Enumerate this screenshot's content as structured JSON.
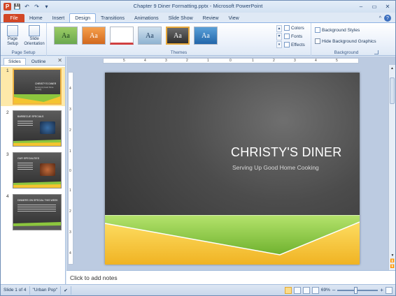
{
  "window": {
    "title": "Chapter 9 Diner Formatting.pptx - Microsoft PowerPoint",
    "app_icon_letter": "P",
    "controls": {
      "minimize": "–",
      "maximize": "▭",
      "close": "✕"
    }
  },
  "qat": {
    "save": "💾",
    "undo": "↶",
    "redo": "↷",
    "customize": "▾"
  },
  "tabs": {
    "file": "File",
    "items": [
      "Home",
      "Insert",
      "Design",
      "Transitions",
      "Animations",
      "Slide Show",
      "Review",
      "View"
    ],
    "active": "Design",
    "minimize_ribbon": "^",
    "help": "?"
  },
  "ribbon": {
    "page_setup": {
      "label": "Page Setup",
      "page_setup_btn": "Page Setup",
      "orientation_btn": "Slide Orientation"
    },
    "themes": {
      "label": "Themes",
      "thumbs": [
        "Aa",
        "Aa",
        "",
        "Aa",
        "Aa",
        "Aa"
      ],
      "colors": "Colors",
      "fonts": "Fonts",
      "effects": "Effects"
    },
    "background": {
      "label": "Background",
      "styles": "Background Styles",
      "hide_graphics": "Hide Background Graphics"
    }
  },
  "left_panel": {
    "tab_slides": "Slides",
    "tab_outline": "Outline",
    "close": "✕",
    "slides": [
      {
        "num": "1",
        "title": "CHRISTY'S DINER",
        "subtitle": "Serving Up Good Home Cooking"
      },
      {
        "num": "2",
        "title": "BARBECUE SPECIALS"
      },
      {
        "num": "3",
        "title": "OUR SPECIALTIES"
      },
      {
        "num": "4",
        "title": "DINNERS ON SPECIAL THIS WEEK"
      }
    ]
  },
  "slide": {
    "title": "CHRISTY'S DINER",
    "subtitle": "Serving Up Good Home Cooking"
  },
  "ruler": {
    "h_ticks": [
      "6",
      "5",
      "4",
      "3",
      "2",
      "1",
      "0",
      "1",
      "2",
      "3",
      "4",
      "5",
      "6"
    ],
    "v_ticks": [
      "4",
      "3",
      "2",
      "1",
      "0",
      "1",
      "2",
      "3",
      "4"
    ]
  },
  "notes": {
    "placeholder": "Click to add notes"
  },
  "status": {
    "slide_info": "Slide 1 of 4",
    "theme": "\"Urban Pop\"",
    "zoom": "69%",
    "minus": "–",
    "plus": "+"
  },
  "colors": {
    "file_tab": "#d24726",
    "accent_green": "#8cc63e",
    "accent_yellow": "#f4c430",
    "selection": "#f0b545"
  }
}
